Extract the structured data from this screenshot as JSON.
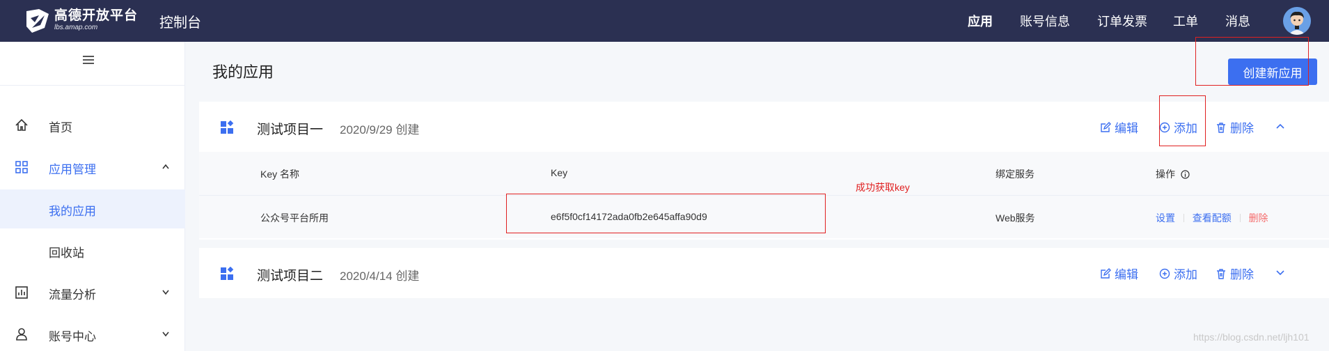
{
  "header": {
    "logo_cn": "高德开放平台",
    "logo_en": "lbs.amap.com",
    "console": "控制台",
    "nav": [
      "应用",
      "账号信息",
      "订单发票",
      "工单",
      "消息"
    ]
  },
  "sidebar": {
    "items": [
      {
        "label": "首页",
        "icon": "home-icon"
      },
      {
        "label": "应用管理",
        "icon": "apps-grid-icon",
        "expanded": true
      },
      {
        "label": "我的应用",
        "selected": true
      },
      {
        "label": "回收站"
      },
      {
        "label": "流量分析",
        "icon": "chart-icon"
      },
      {
        "label": "账号中心",
        "icon": "user-icon"
      }
    ]
  },
  "main": {
    "title": "我的应用",
    "create_button": "创建新应用",
    "projects": [
      {
        "name": "测试项目一",
        "date": "2020/9/29 创建",
        "actions": {
          "edit": "编辑",
          "add": "添加",
          "delete": "删除"
        },
        "table": {
          "columns": [
            "Key 名称",
            "Key",
            "绑定服务",
            "操作"
          ],
          "rows": [
            {
              "name": "公众号平台所用",
              "key": "e6f5f0cf14172ada0fb2e645affa90d9",
              "service": "Web服务",
              "ops": {
                "settings": "设置",
                "view_config": "查看配额",
                "delete": "删除"
              }
            }
          ]
        }
      },
      {
        "name": "测试项目二",
        "date": "2020/4/14 创建",
        "actions": {
          "edit": "编辑",
          "add": "添加",
          "delete": "删除"
        }
      }
    ]
  },
  "annotation": {
    "note": "成功获取key"
  },
  "watermark": "https://blog.csdn.net/ljh101",
  "colors": {
    "topbar": "#2b3052",
    "accent": "#3c6ff0",
    "danger": "#f56c6c",
    "annotation_red": "#e02020"
  }
}
